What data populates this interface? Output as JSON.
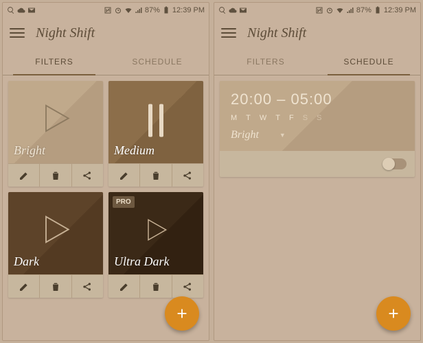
{
  "status": {
    "battery": "87%",
    "time": "12:39 PM"
  },
  "app": {
    "title": "Night Shift",
    "tabs": {
      "filters": "FILTERS",
      "schedule": "SCHEDULE"
    }
  },
  "filters": [
    {
      "name": "Bright",
      "state": "play"
    },
    {
      "name": "Medium",
      "state": "pause"
    },
    {
      "name": "Dark",
      "state": "play"
    },
    {
      "name": "Ultra Dark",
      "state": "play",
      "pro": "PRO"
    }
  ],
  "schedule": {
    "time": "20:00 – 05:00",
    "days": [
      "M",
      "T",
      "W",
      "T",
      "F",
      "S",
      "S"
    ],
    "filter_name": "Bright",
    "enabled": false
  }
}
